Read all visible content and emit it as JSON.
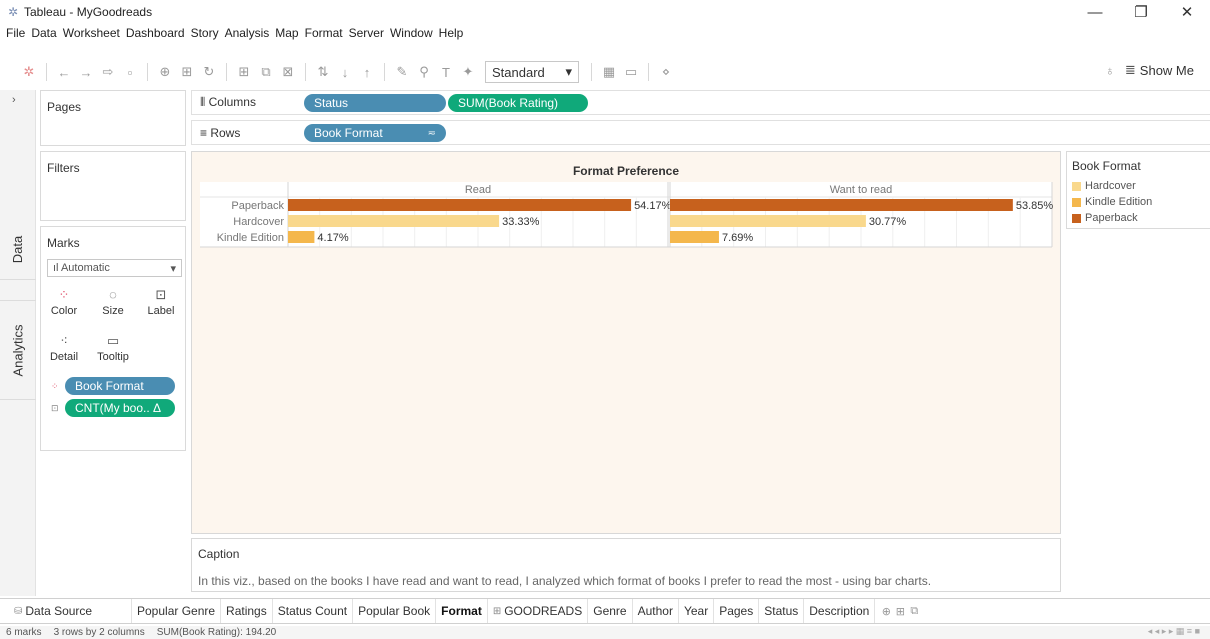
{
  "window": {
    "title": "Tableau - MyGoodreads",
    "controls": {
      "minimize": "—",
      "restore": "❐",
      "close": "✕"
    }
  },
  "menu": [
    "File",
    "Data",
    "Worksheet",
    "Dashboard",
    "Story",
    "Analysis",
    "Map",
    "Format",
    "Server",
    "Window",
    "Help"
  ],
  "toolbar": {
    "fit_select": "Standard",
    "show_me_label": "Show Me"
  },
  "side_tabs": {
    "data": "Data",
    "analytics": "Analytics"
  },
  "cards": {
    "pages": "Pages",
    "filters": "Filters",
    "marks": "Marks",
    "mark_type": "Automatic",
    "buttons": {
      "color": "Color",
      "size": "Size",
      "label": "Label",
      "detail": "Detail",
      "tooltip": "Tooltip"
    },
    "pills": {
      "color_field": "Book Format",
      "label_field": "CNT(My boo.. Δ"
    }
  },
  "shelves": {
    "columns_label": "Columns",
    "rows_label": "Rows",
    "columns": [
      "Status",
      "SUM(Book Rating)"
    ],
    "rows": [
      "Book Format"
    ]
  },
  "legend": {
    "title": "Book Format",
    "items": [
      {
        "label": "Hardcover",
        "color": "#f9d88c"
      },
      {
        "label": "Kindle Edition",
        "color": "#f4b74c"
      },
      {
        "label": "Paperback",
        "color": "#c7611d"
      }
    ]
  },
  "caption": {
    "title": "Caption",
    "text": "In this viz., based on the books I have read  and want to read, I analyzed which format of books I prefer to read the most - using bar charts."
  },
  "chart_data": {
    "type": "bar",
    "title": "Format Preference",
    "categories": [
      "Paperback",
      "Hardcover",
      "Kindle Edition"
    ],
    "panels": [
      {
        "name": "Read",
        "values": [
          54.17,
          33.33,
          4.17
        ],
        "labels": [
          "54.17%",
          "33.33%",
          "4.17%"
        ]
      },
      {
        "name": "Want to read",
        "values": [
          53.85,
          30.77,
          7.69
        ],
        "labels": [
          "53.85%",
          "30.77%",
          "7.69%"
        ]
      }
    ],
    "colors": {
      "Paperback": "#c7611d",
      "Hardcover": "#f9d88c",
      "Kindle Edition": "#f4b74c"
    },
    "xlim": [
      0,
      60
    ],
    "orientation": "horizontal",
    "grid": true
  },
  "sheet_tabs": {
    "data_source": "Data Source",
    "tabs": [
      "Popular Genre",
      "Ratings",
      "Status Count",
      "Popular Book",
      "Format",
      "GOODREADS",
      "Genre",
      "Author",
      "Year",
      "Pages",
      "Status",
      "Description"
    ],
    "active": "Format"
  },
  "status": {
    "marks": "6 marks",
    "dims": "3 rows by 2 columns",
    "sum": "SUM(Book Rating): 194.20"
  }
}
